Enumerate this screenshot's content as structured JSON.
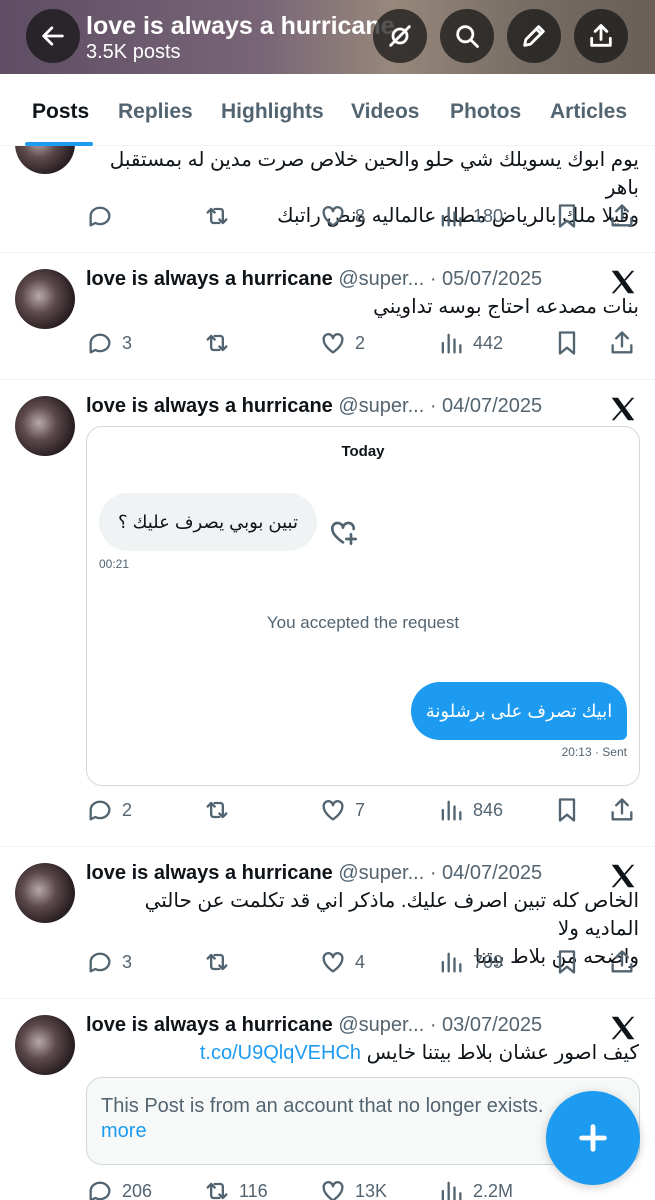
{
  "header": {
    "title": "love is always a hurricane",
    "post_count": "3.5K posts",
    "icons": [
      "back-arrow-icon",
      "mute-icon",
      "search-icon",
      "edit-icon",
      "share-icon"
    ]
  },
  "tabs": [
    "Posts",
    "Replies",
    "Highlights",
    "Videos",
    "Photos",
    "Articles"
  ],
  "posts": [
    {
      "text_lines": [
        "يوم ابوك يسويلك شي حلو والحين خلاص صرت مدين له بمستقبل باهر",
        "وفيلا ملك بالرياض مطله عالماليه ونص راتبك"
      ],
      "replies": "",
      "reposts": "",
      "likes": "8",
      "views": "180"
    },
    {
      "name": "love is always a hurricane",
      "handle": "@super...",
      "date": "· 05/07/2025",
      "text": "بنات مصدعه احتاج بوسه تداويني",
      "replies": "3",
      "reposts": "",
      "likes": "2",
      "views": "442"
    },
    {
      "name": "love is always a hurricane",
      "handle": "@super...",
      "date": "· 04/07/2025",
      "dm": {
        "day": "Today",
        "incoming": "تبين بوبي يصرف عليك ؟",
        "incoming_time": "00:21",
        "system": "You accepted the request",
        "outgoing": "ابيك تصرف على برشلونة",
        "outgoing_time": "20:13 · Sent"
      },
      "replies": "2",
      "reposts": "",
      "likes": "7",
      "views": "846"
    },
    {
      "name": "love is always a hurricane",
      "handle": "@super...",
      "date": "· 04/07/2025",
      "text_lines": [
        "الخاص كله تبين اصرف عليك.  ماذكر اني قد تكلمت عن حالتي الماديه ولا",
        "واضحه من بلاط بيتنا"
      ],
      "replies": "3",
      "reposts": "",
      "likes": "4",
      "views": "709"
    },
    {
      "name": "love is always a hurricane",
      "handle": "@super...",
      "date": "· 03/07/2025",
      "text": "كيف اصور عشان بلاط بيتنا خايس",
      "link": "t.co/U9QlqVEHCh",
      "quote": "This Post is from an account that no longer exists.",
      "quote_more": "more",
      "replies": "206",
      "reposts": "116",
      "likes": "13K",
      "views": "2.2M"
    }
  ],
  "colors": {
    "accent": "#1d9bf0",
    "text": "#0f1419",
    "muted": "#536471"
  }
}
